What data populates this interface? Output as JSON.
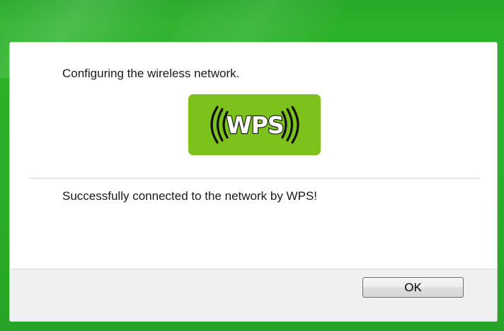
{
  "dialog": {
    "message": "Configuring the wireless network.",
    "badge_text": "WPS",
    "status": "Successfully connected to the network by WPS!",
    "ok_label": "OK"
  },
  "icons": {
    "badge": "wps-icon"
  },
  "colors": {
    "frame": "#2cb12a",
    "badge": "#7cc11c"
  }
}
